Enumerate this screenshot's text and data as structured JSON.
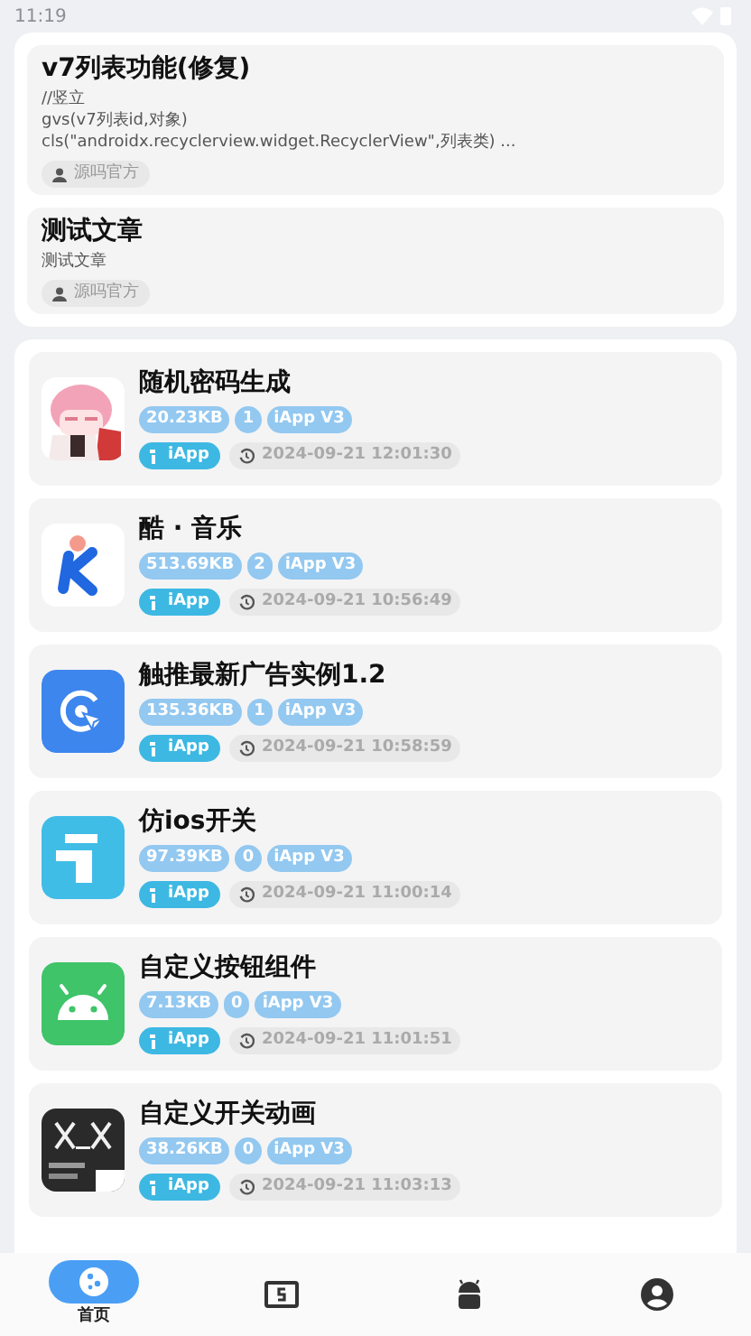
{
  "status_bar": {
    "time": "11:19"
  },
  "posts": [
    {
      "title": "v7列表功能(修复)",
      "lines": [
        "//竖立",
        "gvs(v7列表id,对象)",
        "cls(\"androidx.recyclerview.widget.RecyclerView\",列表类) ..."
      ],
      "author": "源吗官方"
    },
    {
      "title": "测试文章",
      "lines": [
        "测试文章"
      ],
      "author": "源吗官方"
    }
  ],
  "apps": [
    {
      "name": "随机密码生成",
      "size": "20.23KB",
      "count": "1",
      "version": "iApp V3",
      "platform": "iApp",
      "time": "2024-09-21 12:01:30"
    },
    {
      "name": "酷 · 音乐",
      "size": "513.69KB",
      "count": "2",
      "version": "iApp V3",
      "platform": "iApp",
      "time": "2024-09-21 10:56:49"
    },
    {
      "name": "触推最新广告实例1.2",
      "size": "135.36KB",
      "count": "1",
      "version": "iApp V3",
      "platform": "iApp",
      "time": "2024-09-21 10:58:59"
    },
    {
      "name": "仿ios开关",
      "size": "97.39KB",
      "count": "0",
      "version": "iApp V3",
      "platform": "iApp",
      "time": "2024-09-21 11:00:14"
    },
    {
      "name": "自定义按钮组件",
      "size": "7.13KB",
      "count": "0",
      "version": "iApp V3",
      "platform": "iApp",
      "time": "2024-09-21 11:01:51"
    },
    {
      "name": "自定义开关动画",
      "size": "38.26KB",
      "count": "0",
      "version": "iApp V3",
      "platform": "iApp",
      "time": "2024-09-21 11:03:13"
    }
  ],
  "nav": [
    {
      "kind": "home",
      "label": "首页",
      "selected": true
    },
    {
      "kind": "money",
      "selected": false
    },
    {
      "kind": "android",
      "selected": false
    },
    {
      "kind": "user",
      "selected": false
    }
  ]
}
